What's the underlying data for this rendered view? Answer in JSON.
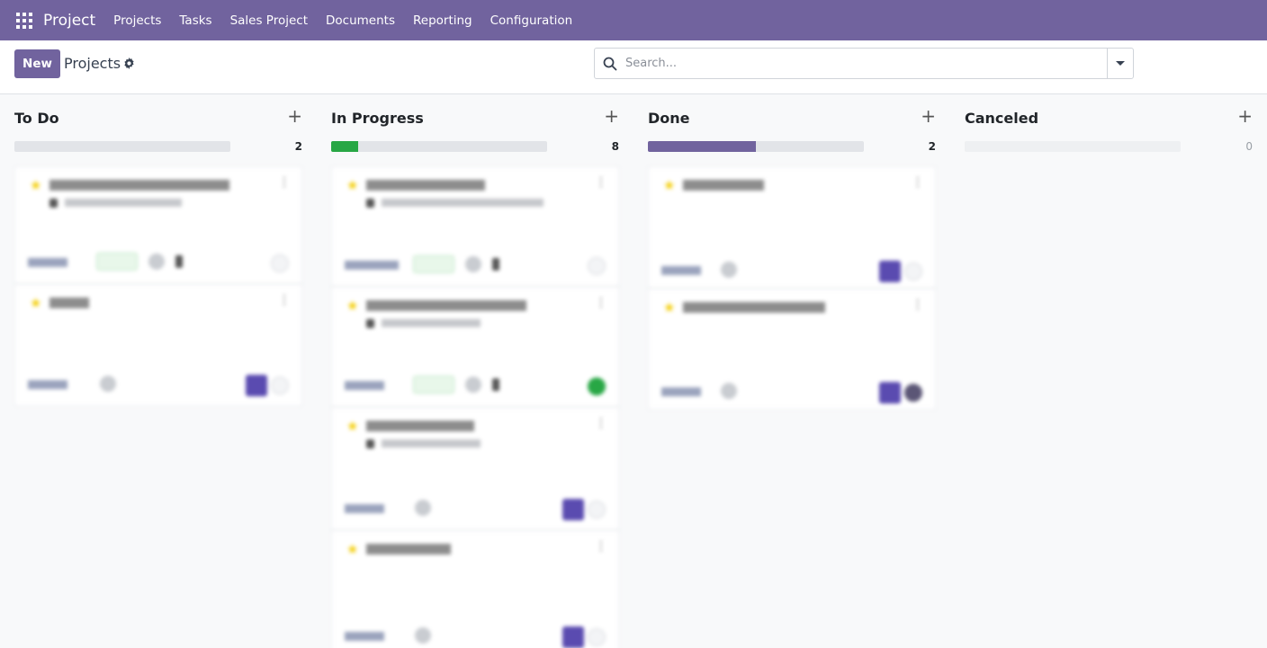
{
  "navbar": {
    "app_title": "Project",
    "menu": [
      "Projects",
      "Tasks",
      "Sales Project",
      "Documents",
      "Reporting",
      "Configuration"
    ],
    "background_color": "#71639e"
  },
  "control_panel": {
    "new_label": "New",
    "breadcrumb": "Projects",
    "search_placeholder": "Search..."
  },
  "columns": [
    {
      "title": "To Do",
      "count": "2",
      "progress": {
        "fraction": 0,
        "color": "#28a745"
      }
    },
    {
      "title": "In Progress",
      "count": "8",
      "progress": {
        "fraction": 0.125,
        "color": "#28a745"
      }
    },
    {
      "title": "Done",
      "count": "2",
      "progress": {
        "fraction": 0.5,
        "color": "#71639e"
      }
    },
    {
      "title": "Canceled",
      "count": "0",
      "progress": {
        "fraction": 0,
        "color": "#71639e"
      }
    }
  ]
}
